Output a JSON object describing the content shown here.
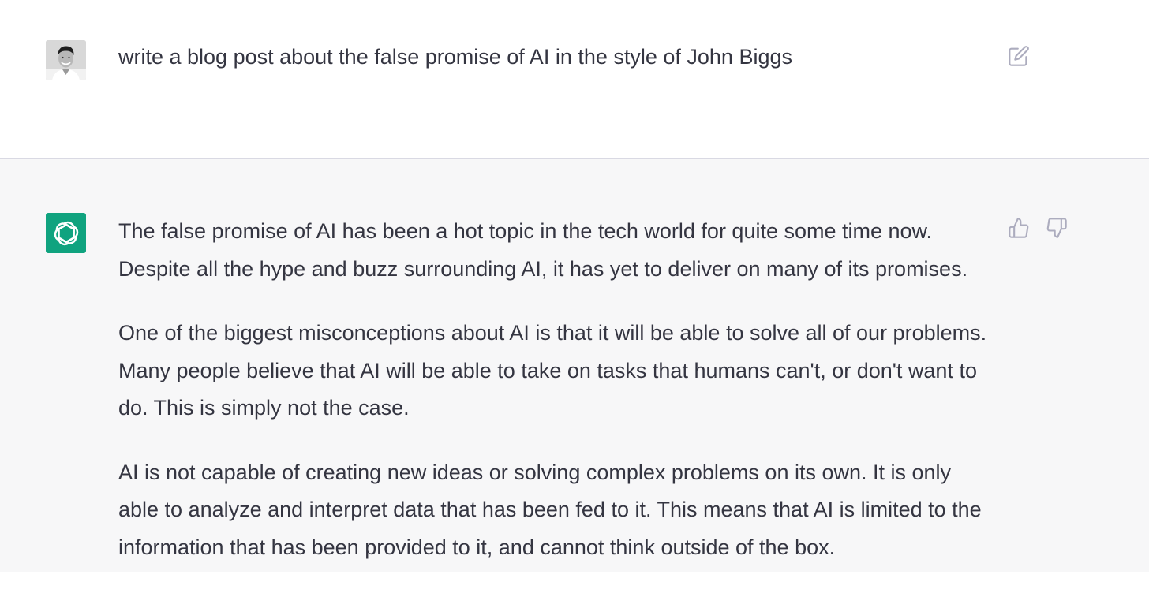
{
  "user_message": {
    "text": "write a blog post about the false promise of AI in the style of John Biggs",
    "avatar_icon": "user-photo-avatar",
    "edit_icon": "edit-icon"
  },
  "assistant_message": {
    "avatar_icon": "openai-logo-icon",
    "avatar_color": "#10a37f",
    "paragraphs": [
      "The false promise of AI has been a hot topic in the tech world for quite some time now. Despite all the hype and buzz surrounding AI, it has yet to deliver on many of its promises.",
      "One of the biggest misconceptions about AI is that it will be able to solve all of our problems. Many people believe that AI will be able to take on tasks that humans can't, or don't want to do. This is simply not the case.",
      "AI is not capable of creating new ideas or solving complex problems on its own. It is only able to analyze and interpret data that has been fed to it. This means that AI is limited to the information that has been provided to it, and cannot think outside of the box."
    ],
    "feedback_icons": [
      "thumbs-up-icon",
      "thumbs-down-icon"
    ]
  },
  "colors": {
    "text": "#343541",
    "assistant_background": "#f7f7f8",
    "user_background": "#ffffff",
    "icon_gray": "#acacbe"
  }
}
